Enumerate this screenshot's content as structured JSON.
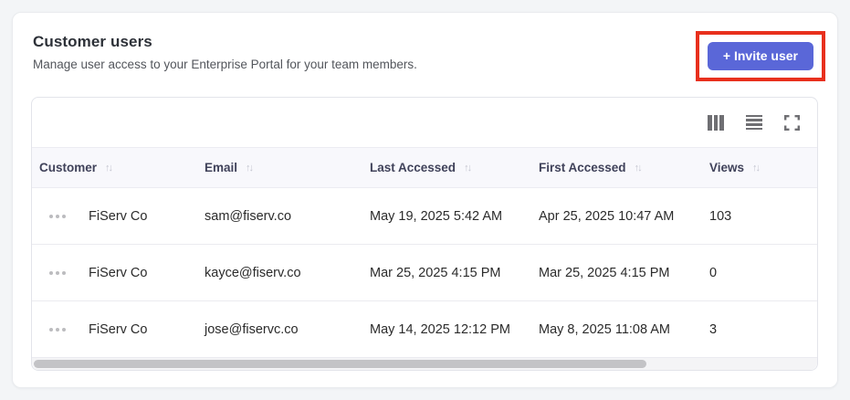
{
  "header": {
    "title": "Customer users",
    "subtitle": "Manage user access to your Enterprise Portal for your team members.",
    "invite_button_label": "+ Invite user"
  },
  "colors": {
    "accent_button": "#5a67d8",
    "annotation_highlight": "#e8301d",
    "table_header_bg": "#f8f8fc"
  },
  "toolbar": {
    "icons": [
      "columns-icon",
      "density-icon",
      "fullscreen-icon"
    ]
  },
  "table": {
    "sort_icon": "↑↓",
    "columns": [
      {
        "label": "Customer",
        "sortable": true
      },
      {
        "label": "Email",
        "sortable": true
      },
      {
        "label": "Last Accessed",
        "sortable": true
      },
      {
        "label": "First Accessed",
        "sortable": true
      },
      {
        "label": "Views",
        "sortable": true
      }
    ],
    "rows": [
      {
        "customer": "FiServ Co",
        "email": "sam@fiserv.co",
        "last_accessed": "May 19, 2025 5:42 AM",
        "first_accessed": "Apr 25, 2025 10:47 AM",
        "views": "103"
      },
      {
        "customer": "FiServ Co",
        "email": "kayce@fiserv.co",
        "last_accessed": "Mar 25, 2025 4:15 PM",
        "first_accessed": "Mar 25, 2025 4:15 PM",
        "views": "0"
      },
      {
        "customer": "FiServ Co",
        "email": "jose@fiservc.co",
        "last_accessed": "May 14, 2025 12:12 PM",
        "first_accessed": "May 8, 2025 11:08 AM",
        "views": "3"
      }
    ]
  },
  "scrollbar": {
    "horizontal_thumb_percent": 78
  }
}
